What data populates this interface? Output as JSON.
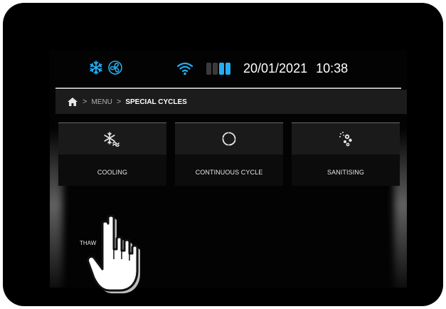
{
  "status_bar": {
    "icons": [
      "snowflake-icon",
      "fan-icon",
      "wifi-icon",
      "battery-icon"
    ],
    "battery_level": 0.5,
    "date": "20/01/2021",
    "time": "10:38"
  },
  "breadcrumb": {
    "home_icon": "home-icon",
    "menu": "MENU",
    "current": "SPECIAL CYCLES"
  },
  "tiles": [
    {
      "label": "COOLING",
      "icon": "cooling-icon"
    },
    {
      "label": "CONTINUOUS CYCLE",
      "icon": "continuous-cycle-icon"
    },
    {
      "label": "SANITISING",
      "icon": "sanitising-icon"
    }
  ],
  "thaw": {
    "label": "THAW"
  },
  "overlay": {
    "icon": "pointing-hand-icon"
  },
  "colors": {
    "accent": "#24aef1",
    "background": "#000000",
    "tile": "#1a1a1a"
  }
}
